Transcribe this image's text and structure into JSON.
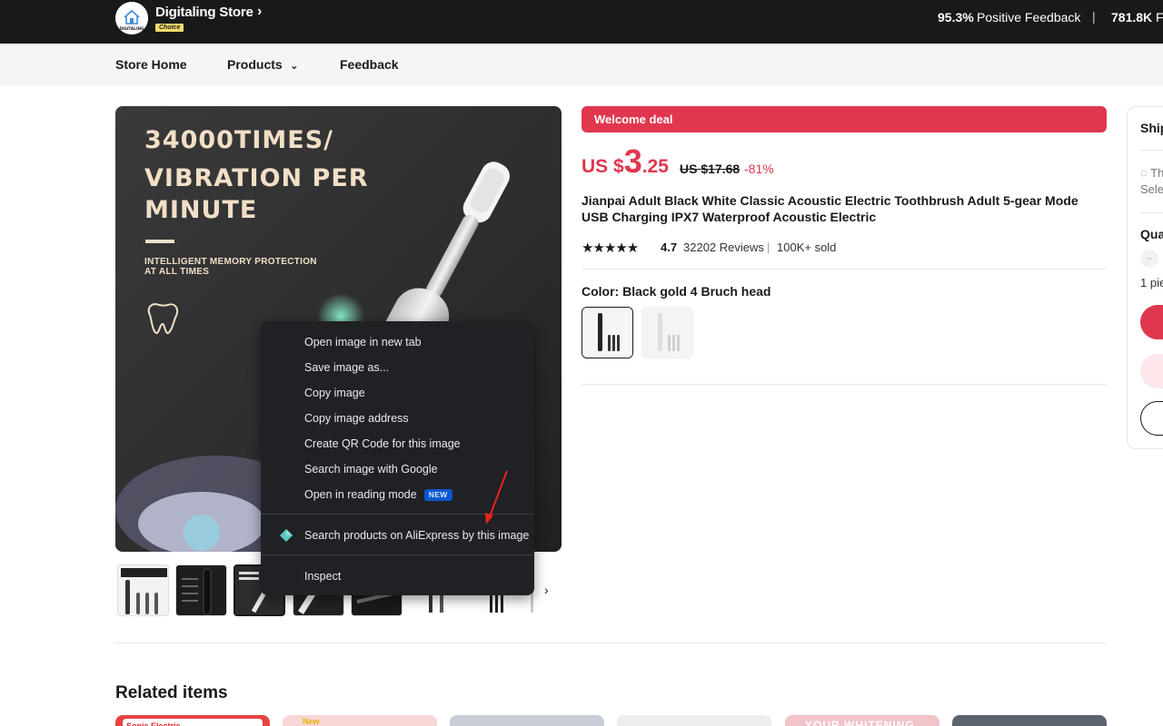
{
  "store": {
    "name": "Digitaling Store",
    "logo_text": "DIGITALING",
    "badge": "Choice",
    "feedback_pct": "95.3%",
    "feedback_label": "Positive Feedback",
    "separator": "|",
    "followers_count": "781.8K",
    "followers_label": "Fo"
  },
  "nav": {
    "items": [
      {
        "label": "Store Home"
      },
      {
        "label": "Products"
      },
      {
        "label": "Feedback"
      }
    ]
  },
  "main_image": {
    "headline_lines": [
      "34000TIMES/",
      "VIBRATION PER",
      "MINUTE"
    ],
    "sub_lines": [
      "INTELLIGENT MEMORY PROTECTION",
      "AT ALL TIMES"
    ]
  },
  "thumbnails": {
    "count": 8,
    "active_index": 2,
    "items": [
      {
        "caption": "Sonic Electric Toothbrush"
      },
      {
        "caption": "5 Gear Intelligent Mode"
      },
      {
        "caption": "34000 Times Vibration Per Minute"
      },
      {
        "caption": ""
      },
      {
        "caption": ""
      },
      {
        "caption": ""
      },
      {
        "caption": ""
      },
      {
        "caption": ""
      }
    ]
  },
  "product": {
    "welcome_deal": "Welcome deal",
    "price_currency": "US $",
    "price_int": "3",
    "price_dec": ".25",
    "original_price": "US $17.68",
    "discount": "-81%",
    "title": "Jianpai Adult Black White Classic Acoustic Electric Toothbrush Adult 5-gear Mode USB Charging IPX7 Waterproof Acoustic Electric",
    "stars": "★★★★★",
    "rating": "4.7",
    "reviews": "32202 Reviews",
    "rating_separator": "|",
    "sold": "100K+ sold",
    "color_label": "Color: Black gold 4 Bruch head"
  },
  "sidebar": {
    "ship_label": "Ship",
    "info_line1": "Th",
    "info_line2": "Sele",
    "qty_label": "Qua",
    "minus": "−",
    "pieces": "1 pie"
  },
  "related": {
    "title": "Related items",
    "cards": [
      {
        "label": "Sonic Electric"
      },
      {
        "label": "New"
      },
      {
        "label": ""
      },
      {
        "label": ""
      },
      {
        "label": "YOUR WHITENING"
      },
      {
        "label": ""
      }
    ]
  },
  "context_menu": {
    "items": [
      {
        "label": "Open image in new tab"
      },
      {
        "label": "Save image as..."
      },
      {
        "label": "Copy image"
      },
      {
        "label": "Copy image address"
      },
      {
        "label": "Create QR Code for this image"
      },
      {
        "label": "Search image with Google"
      },
      {
        "label": "Open in reading mode",
        "badge": "NEW"
      },
      {
        "label": "Search products on AliExpress by this image"
      },
      {
        "label": "Inspect"
      }
    ]
  },
  "colors": {
    "accent": "#e0374f",
    "topbar": "#191919",
    "menu_bg": "#202124",
    "badge_blue": "#0b57d0",
    "annotation_arrow": "#e8241c"
  }
}
